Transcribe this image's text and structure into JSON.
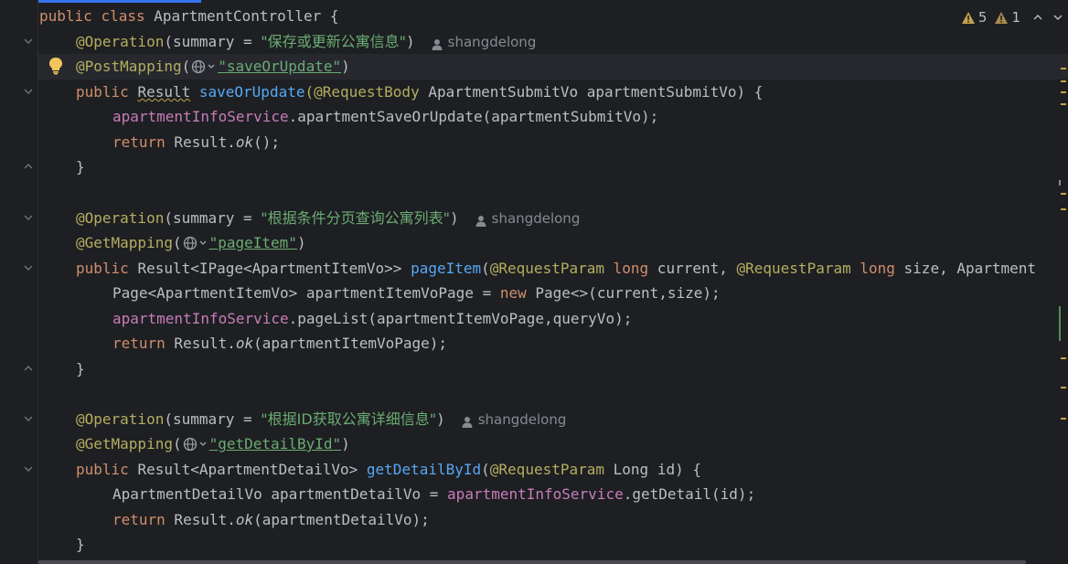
{
  "editor": {
    "class_line": {
      "kw1": "public",
      "kw2": "class",
      "name": "ApartmentController {"
    },
    "blocks": [
      {
        "op_annot": "@Operation",
        "op_open": "(summary = ",
        "summary": "\"保存或更新公寓信息\"",
        "op_close": ")",
        "author": "shangdelong",
        "mapping_annot": "@PostMapping",
        "mapping_path": "\"saveOrUpdate\"",
        "sig_kw": "public",
        "sig_ret": "Result",
        "sig_name": "saveOrUpdate",
        "sig_params_annot": "(@RequestBody",
        "sig_params_rest": " ApartmentSubmitVo apartmentSubmitVo) {",
        "body1_field": "apartmentInfoService",
        "body1_rest": ".apartmentSaveOrUpdate(apartmentSubmitVo);",
        "ret_kw": "return",
        "ret_a": " Result.",
        "ret_ok": "ok",
        "ret_b": "();"
      },
      {
        "op_annot": "@Operation",
        "op_open": "(summary = ",
        "summary": "\"根据条件分页查询公寓列表\"",
        "op_close": ")",
        "author": "shangdelong",
        "mapping_annot": "@GetMapping",
        "mapping_path": "\"pageItem\"",
        "sig_kw": "public",
        "sig_ret": "Result<IPage<ApartmentItemVo>>",
        "sig_name": "pageItem",
        "sig_a": "(",
        "sig_b": "@RequestParam",
        "sig_c": "long",
        "sig_d": " current, ",
        "sig_e": "@RequestParam",
        "sig_f": "long",
        "sig_g": " size, Apartment",
        "body0_a": "Page<ApartmentItemVo> apartmentItemVoPage = ",
        "body0_new": "new",
        "body0_b": " Page<>(current,size);",
        "body1_field": "apartmentInfoService",
        "body1_rest": ".pageList(apartmentItemVoPage,queryVo);",
        "ret_kw": "return",
        "ret_a": " Result.",
        "ret_ok": "ok",
        "ret_b": "(apartmentItemVoPage);"
      },
      {
        "op_annot": "@Operation",
        "op_open": "(summary = ",
        "summary": "\"根据ID获取公寓详细信息\"",
        "op_close": ")",
        "author": "shangdelong",
        "mapping_annot": "@GetMapping",
        "mapping_path": "\"getDetailById\"",
        "sig_kw": "public",
        "sig_ret": "Result<ApartmentDetailVo>",
        "sig_name": "getDetailById",
        "sig_a": "(",
        "sig_b": "@RequestParam",
        "sig_c": " Long id) {",
        "body0_a": "ApartmentDetailVo apartmentDetailVo = ",
        "body0_field": "apartmentInfoService",
        "body0_b": ".getDetail(id);",
        "ret_kw": "return",
        "ret_a": " Result.",
        "ret_ok": "ok",
        "ret_b": "(apartmentDetailVo);"
      }
    ],
    "closing_brace": "}"
  },
  "indicators": {
    "warnings": "5",
    "weak_warnings": "1"
  },
  "colors": {
    "background": "#1e1f22",
    "keyword": "#cf8e6d",
    "annotation": "#b3ae60",
    "string": "#6aab73",
    "function": "#56a8f5",
    "field": "#c77dbb",
    "text": "#bcbec4",
    "warning": "#c3a24b"
  }
}
